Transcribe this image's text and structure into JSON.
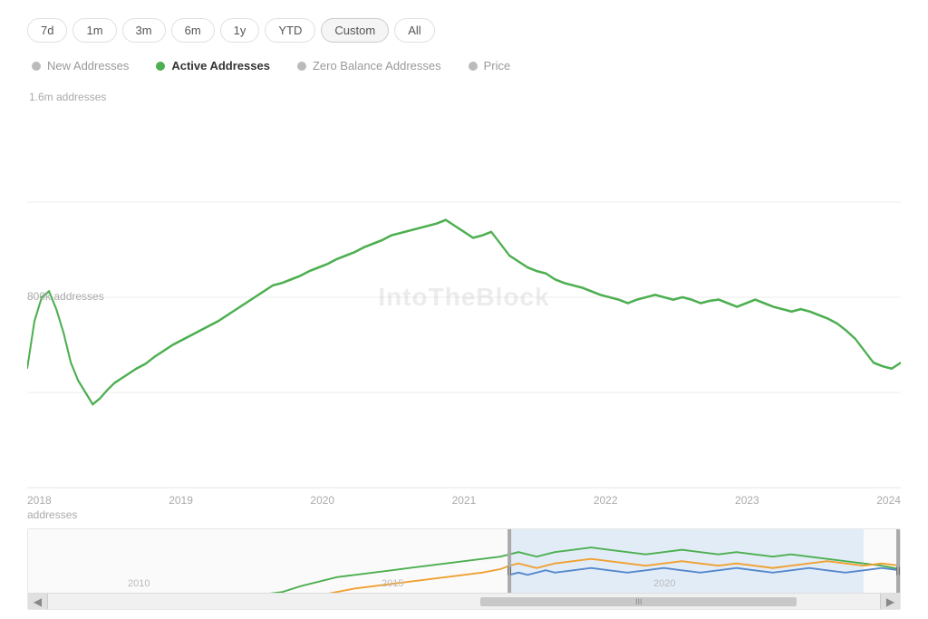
{
  "timeButtons": [
    {
      "label": "7d",
      "id": "7d"
    },
    {
      "label": "1m",
      "id": "1m"
    },
    {
      "label": "3m",
      "id": "3m"
    },
    {
      "label": "6m",
      "id": "6m"
    },
    {
      "label": "1y",
      "id": "1y"
    },
    {
      "label": "YTD",
      "id": "ytd"
    },
    {
      "label": "Custom",
      "id": "custom",
      "active": true
    },
    {
      "label": "All",
      "id": "all"
    }
  ],
  "legend": [
    {
      "label": "New Addresses",
      "color": "#bbb",
      "active": false
    },
    {
      "label": "Active Addresses",
      "color": "#4caf50",
      "active": true
    },
    {
      "label": "Zero Balance Addresses",
      "color": "#bbb",
      "active": false
    },
    {
      "label": "Price",
      "color": "#bbb",
      "active": false
    }
  ],
  "yLabels": {
    "top": "1.6m addresses",
    "mid": "800k addresses",
    "bottom": "addresses"
  },
  "xLabels": [
    "2018",
    "2019",
    "2020",
    "2021",
    "2022",
    "2023",
    "2024"
  ],
  "miniXLabels": [
    "2010",
    "2015",
    "2020"
  ],
  "watermark": "IntoTheBlock"
}
